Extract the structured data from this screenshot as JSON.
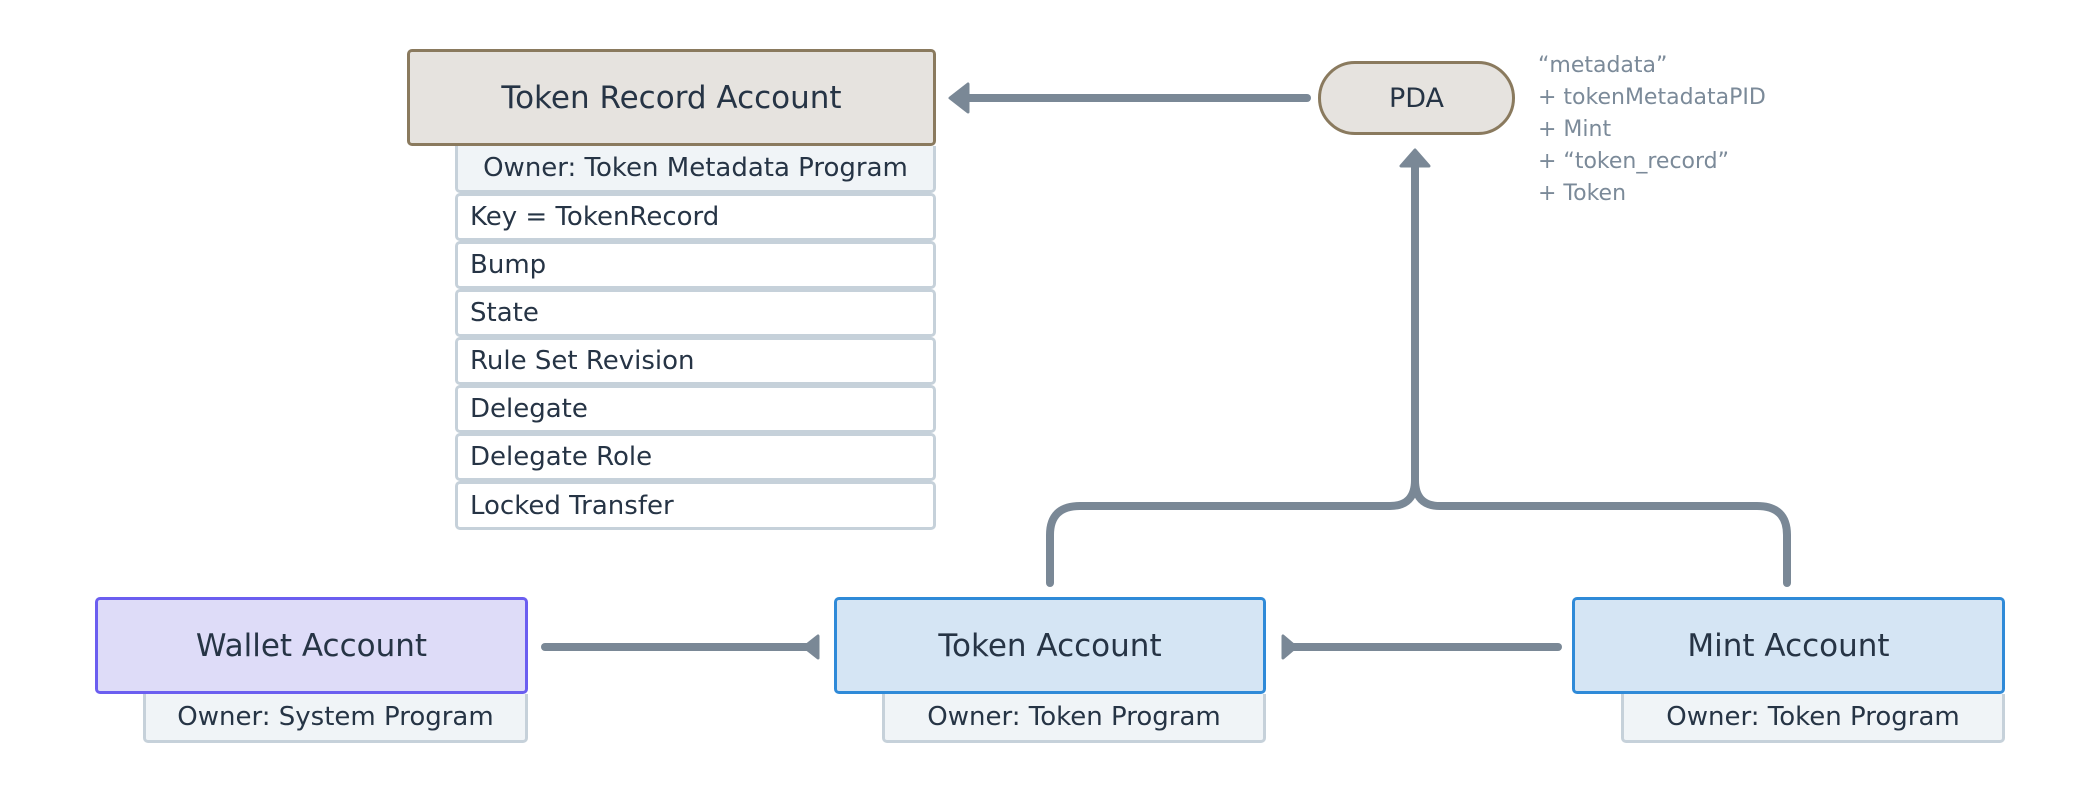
{
  "token_record": {
    "title": "Token Record Account",
    "owner": "Owner: Token Metadata Program",
    "fields": [
      "Key = TokenRecord",
      "Bump",
      "State",
      "Rule Set Revision",
      "Delegate",
      "Delegate Role",
      "Locked Transfer"
    ]
  },
  "pda": {
    "label": "PDA",
    "seeds": [
      "“metadata”",
      "+ tokenMetadataPID",
      "+ Mint",
      "+ “token_record”",
      "+ Token"
    ]
  },
  "wallet": {
    "title": "Wallet Account",
    "owner": "Owner: System Program"
  },
  "token": {
    "title": "Token Account",
    "owner": "Owner: Token Program"
  },
  "mint": {
    "title": "Mint Account",
    "owner": "Owner: Token Program"
  },
  "colors": {
    "connector": "#7a8896",
    "brown_border": "#8a7a5e",
    "blue_border": "#2f8ad8",
    "purple_border": "#6b5ef0"
  }
}
